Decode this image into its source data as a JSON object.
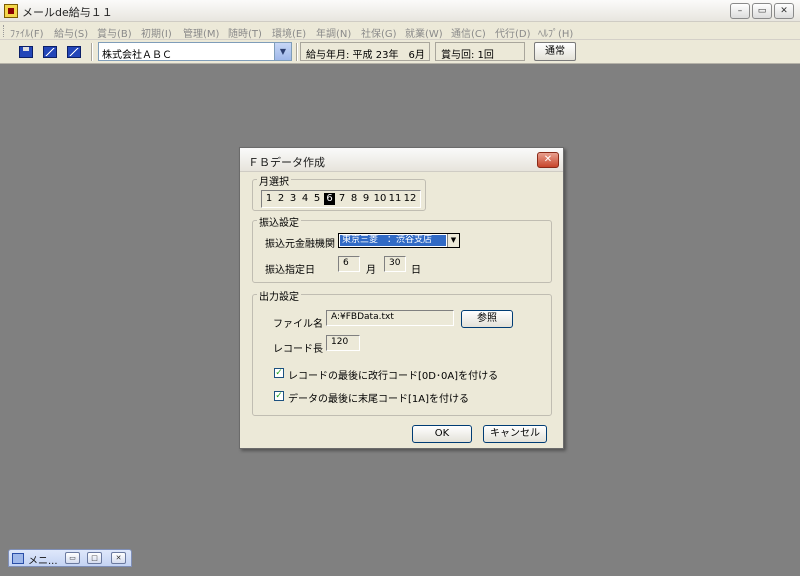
{
  "app": {
    "title": "メールde給与１１",
    "controls": {
      "minimize": "–",
      "restore": "▭",
      "close": "✕"
    }
  },
  "menu": [
    "ﾌｧｲﾙ(F)",
    "給与(S)",
    "賞与(B)",
    "初期(I)",
    "管理(M)",
    "随時(T)",
    "環境(E)",
    "年調(N)",
    "社保(G)",
    "就業(W)",
    "通信(C)",
    "代行(D)",
    "ﾍﾙﾌﾟ(H)"
  ],
  "toolbar": {
    "company": "株式会社ＡＢＣ",
    "pay_month": "給与年月: 平成 23年　6月",
    "bonus_count": "賞与回: 1回",
    "mode_button": "通常"
  },
  "minimized": {
    "label": "メニ..."
  },
  "dialog": {
    "title": "ＦＢデータ作成",
    "close": "✕",
    "month_group": {
      "label": "月選択",
      "months": [
        "1",
        "2",
        "3",
        "4",
        "5",
        "6",
        "7",
        "8",
        "9",
        "10",
        "11",
        "12"
      ],
      "selected": "6"
    },
    "transfer_group": {
      "label": "振込設定",
      "bank_label": "振込元金融機関",
      "bank_value": "東京三菱　：渋谷支店",
      "date_label": "振込指定日",
      "month_value": "6",
      "month_unit": "月",
      "day_value": "30",
      "day_unit": "日"
    },
    "output_group": {
      "label": "出力設定",
      "file_label": "ファイル名",
      "file_value": "A:¥FBData.txt",
      "browse_button": "参照",
      "record_label": "レコード長",
      "record_value": "120",
      "check1": {
        "checked": true,
        "label": "レコードの最後に改行コード[0D･0A]を付ける"
      },
      "check2": {
        "checked": true,
        "label": "データの最後に末尾コード[1A]を付ける"
      }
    },
    "ok_button": "OK",
    "cancel_button": "キャンセル"
  },
  "colors": {
    "desktop": "#808080",
    "dialog_bg": "#ece9d8",
    "selection": "#316ac5",
    "close_button": "#c7452b"
  }
}
